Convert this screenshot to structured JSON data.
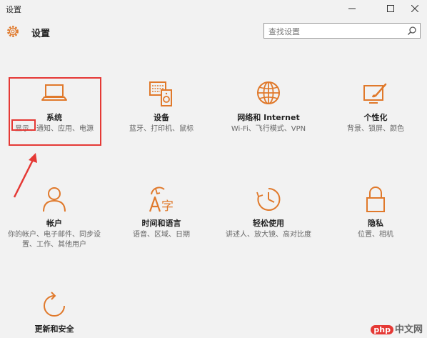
{
  "window": {
    "title": "设置",
    "controls": [
      "minimize-icon",
      "maximize-icon",
      "close-icon"
    ]
  },
  "header": {
    "title": "设置",
    "icon": "gear-icon"
  },
  "search": {
    "placeholder": "查找设置",
    "icon": "search-icon"
  },
  "accent_color": "#e0792b",
  "highlight_color": "#e53935",
  "tiles": [
    {
      "name": "系统",
      "desc": "显示、通知、应用、电源",
      "icon": "laptop-icon"
    },
    {
      "name": "设备",
      "desc": "蓝牙、打印机、鼠标",
      "icon": "devices-icon"
    },
    {
      "name": "网络和 Internet",
      "desc": "Wi-Fi、飞行模式、VPN",
      "icon": "globe-icon"
    },
    {
      "name": "个性化",
      "desc": "背景、锁屏、颜色",
      "icon": "paint-icon"
    },
    {
      "name": "帐户",
      "desc": "你的帐户、电子邮件、同步设置、工作、其他用户",
      "icon": "person-icon"
    },
    {
      "name": "时间和语言",
      "desc": "语音、区域、日期",
      "icon": "time-language-icon"
    },
    {
      "name": "轻松使用",
      "desc": "讲述人、放大镜、高对比度",
      "icon": "ease-of-access-icon"
    },
    {
      "name": "隐私",
      "desc": "位置、相机",
      "icon": "lock-icon"
    },
    {
      "name": "更新和安全",
      "desc": "",
      "icon": "update-icon"
    }
  ],
  "watermark": {
    "brand": "php",
    "site": "中文网"
  }
}
